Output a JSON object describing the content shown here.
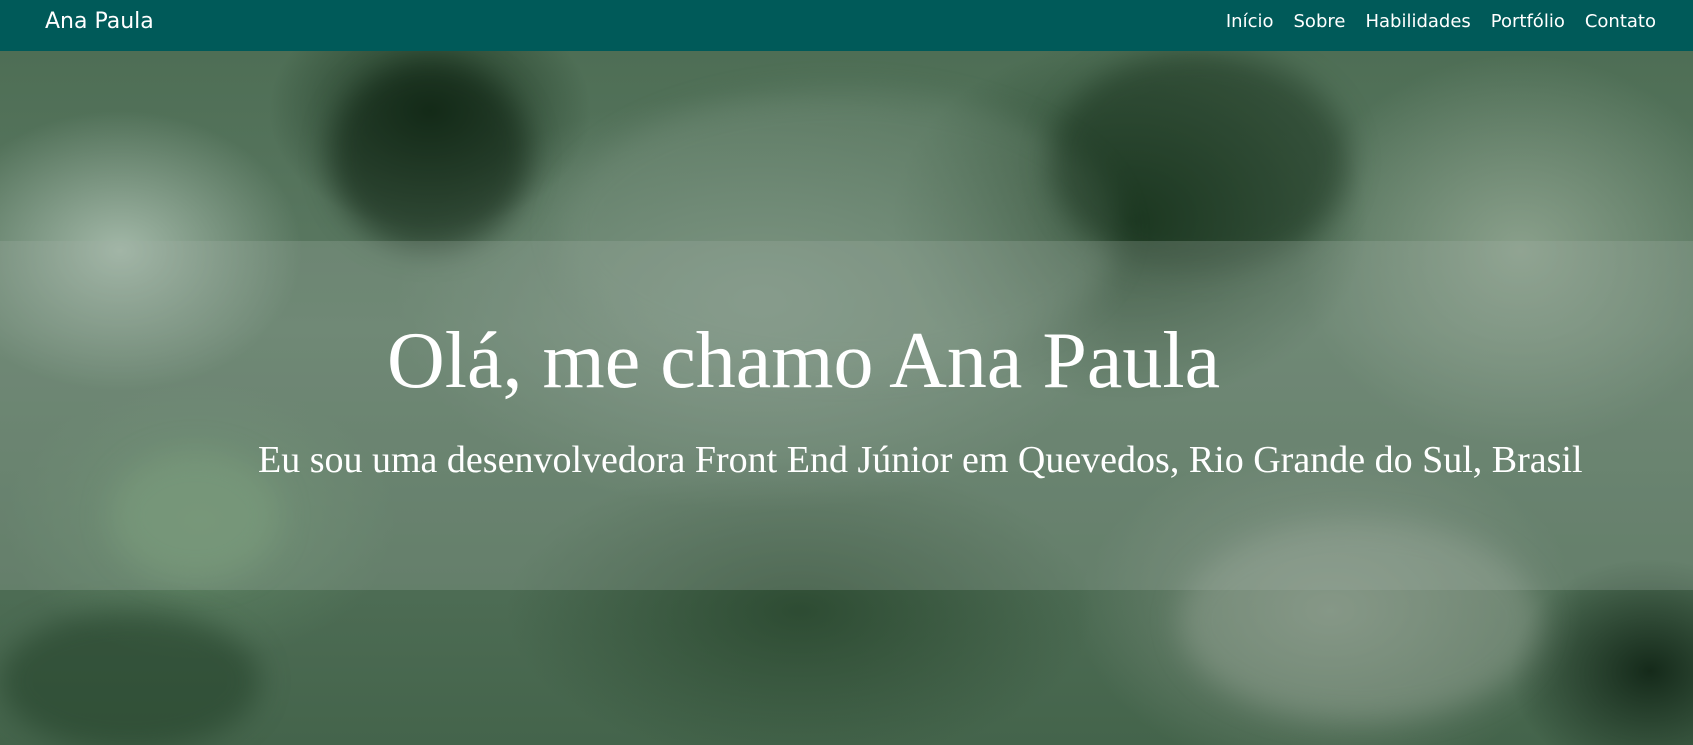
{
  "navbar": {
    "brand": "Ana Paula",
    "links": [
      {
        "label": "Início"
      },
      {
        "label": "Sobre"
      },
      {
        "label": "Habilidades"
      },
      {
        "label": "Portfólio"
      },
      {
        "label": "Contato"
      }
    ],
    "background_color": "#005a59"
  },
  "hero": {
    "title": "Olá, me chamo Ana Paula",
    "subtitle": "Eu sou uma desenvolvedora Front End Júnior em Quevedos, Rio Grande do Sul, Brasil",
    "text_color": "#ffffff"
  }
}
